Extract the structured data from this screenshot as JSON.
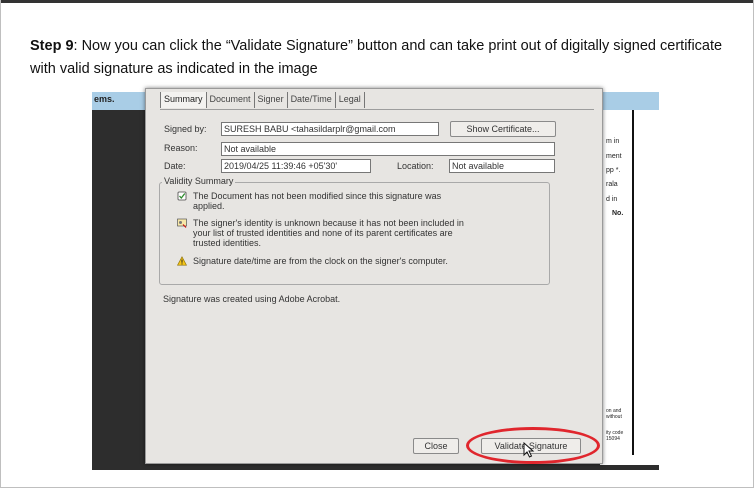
{
  "step": {
    "label": "Step 9",
    "text": ": Now you can click the “Validate Signature” button and can take print out of digitally signed certificate with valid signature as indicated in the image"
  },
  "screenshot": {
    "left_label": "ems.",
    "right_snippets": [
      "m in",
      "ment",
      "pp *.",
      "rala",
      "d in",
      "No.",
      "on and",
      "without",
      "ity code",
      "15094"
    ],
    "tabs": [
      "Summary",
      "Document",
      "Signer",
      "Date/Time",
      "Legal"
    ],
    "active_tab": "Summary",
    "signed_by_label": "Signed by:",
    "signed_by_value": "SURESH BABU <tahasildarplr@gmail.com",
    "show_certificate_label": "Show Certificate...",
    "reason_label": "Reason:",
    "reason_value": "Not available",
    "date_label": "Date:",
    "date_value": "2019/04/25 11:39:46 +05'30'",
    "location_label": "Location:",
    "location_value": "Not available",
    "validity_title": "Validity Summary",
    "validity_items": [
      {
        "icon": "document-unmodified-icon",
        "lines": [
          "The Document has not been modified since this signature was",
          "applied."
        ]
      },
      {
        "icon": "unknown-identity-icon",
        "lines": [
          "The signer's identity is unknown because it has not been included in",
          "your list of trusted identities and none of its parent certificates are",
          "trusted identities."
        ]
      },
      {
        "icon": "warning-icon",
        "lines": [
          "Signature date/time are from the clock on the signer's computer."
        ]
      }
    ],
    "signature_note": "Signature was created using Adobe Acrobat.",
    "close_label": "Close",
    "validate_label": "Validate Signature",
    "highlight_color": "#e0262d"
  }
}
